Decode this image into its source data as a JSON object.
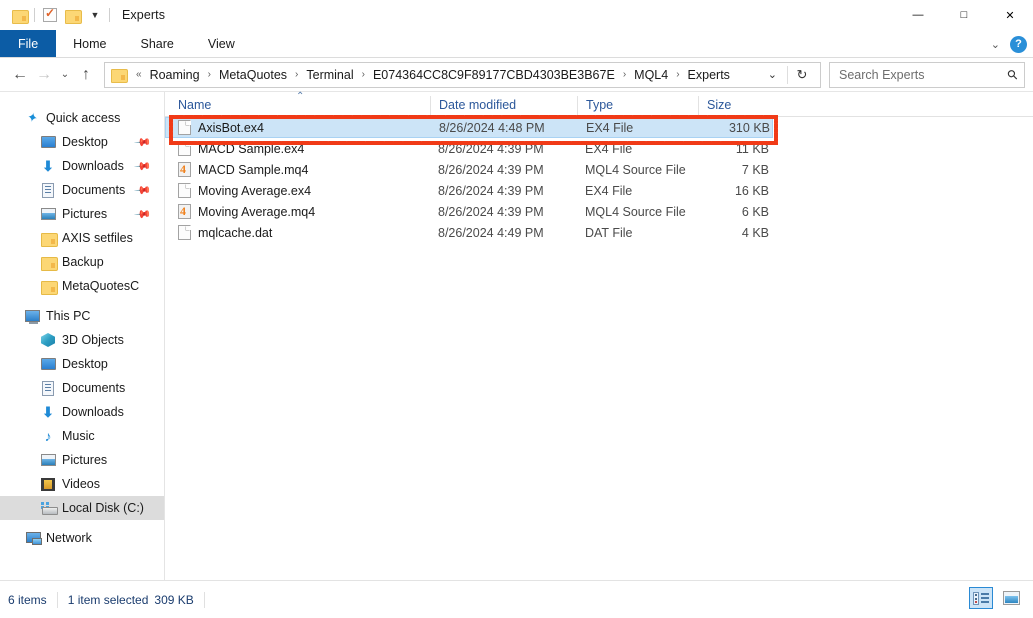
{
  "window": {
    "title": "Experts",
    "quick_access": [
      {
        "name": "folder-icon",
        "label": "Folder"
      },
      {
        "name": "properties-icon",
        "label": "Properties"
      },
      {
        "name": "new-folder-icon",
        "label": "New folder"
      },
      {
        "name": "customize-qat-caret",
        "label": "Customize Quick Access Toolbar"
      }
    ],
    "controls": {
      "minimize": "—",
      "maximize": "□",
      "close": "✕"
    }
  },
  "ribbon": {
    "tabs": [
      {
        "label": "File",
        "active": true
      },
      {
        "label": "Home",
        "active": false
      },
      {
        "label": "Share",
        "active": false
      },
      {
        "label": "View",
        "active": false
      }
    ],
    "collapse_caret": "⌄",
    "help_label": "?"
  },
  "address_bar": {
    "back": "←",
    "forward": "→",
    "recent": "⌄",
    "up": "↑",
    "overflow": "«",
    "crumbs": [
      "Roaming",
      "MetaQuotes",
      "Terminal",
      "E074364CC8C9F89177CBD4303BE3B67E",
      "MQL4",
      "Experts"
    ],
    "separator": "›",
    "dropdown_caret": "⌄",
    "refresh": "↻"
  },
  "search": {
    "placeholder": "Search Experts",
    "value": "",
    "icon": "search-icon"
  },
  "nav_pane": {
    "items": [
      {
        "label": "Quick access",
        "icon": "star-pin-icon",
        "level": 0,
        "group": true,
        "pinned": false,
        "selected": false
      },
      {
        "label": "Desktop",
        "icon": "desktop-icon",
        "level": 1,
        "pinned": true,
        "selected": false
      },
      {
        "label": "Downloads",
        "icon": "downloads-icon",
        "level": 1,
        "pinned": true,
        "selected": false
      },
      {
        "label": "Documents",
        "icon": "documents-icon",
        "level": 1,
        "pinned": true,
        "selected": false
      },
      {
        "label": "Pictures",
        "icon": "pictures-icon",
        "level": 1,
        "pinned": true,
        "selected": false
      },
      {
        "label": "AXIS setfiles",
        "icon": "folder-icon",
        "level": 1,
        "pinned": false,
        "selected": false
      },
      {
        "label": "Backup",
        "icon": "folder-icon",
        "level": 1,
        "pinned": false,
        "selected": false
      },
      {
        "label": "MetaQuotesC",
        "icon": "folder-icon",
        "level": 1,
        "pinned": false,
        "selected": false
      },
      {
        "label": "This PC",
        "icon": "this-pc-icon",
        "level": 0,
        "group": true,
        "pinned": false,
        "selected": false
      },
      {
        "label": "3D Objects",
        "icon": "3d-objects-icon",
        "level": 1,
        "pinned": false,
        "selected": false
      },
      {
        "label": "Desktop",
        "icon": "desktop-icon",
        "level": 1,
        "pinned": false,
        "selected": false
      },
      {
        "label": "Documents",
        "icon": "documents-icon",
        "level": 1,
        "pinned": false,
        "selected": false
      },
      {
        "label": "Downloads",
        "icon": "downloads-icon",
        "level": 1,
        "pinned": false,
        "selected": false
      },
      {
        "label": "Music",
        "icon": "music-icon",
        "level": 1,
        "pinned": false,
        "selected": false
      },
      {
        "label": "Pictures",
        "icon": "pictures-icon",
        "level": 1,
        "pinned": false,
        "selected": false
      },
      {
        "label": "Videos",
        "icon": "videos-icon",
        "level": 1,
        "pinned": false,
        "selected": false
      },
      {
        "label": "Local Disk (C:)",
        "icon": "local-disk-icon",
        "level": 1,
        "pinned": false,
        "selected": true
      },
      {
        "label": "Network",
        "icon": "network-icon",
        "level": 0,
        "group": true,
        "pinned": false,
        "selected": false
      }
    ]
  },
  "file_list": {
    "columns": [
      {
        "label": "Name",
        "key": "name"
      },
      {
        "label": "Date modified",
        "key": "date"
      },
      {
        "label": "Type",
        "key": "type"
      },
      {
        "label": "Size",
        "key": "size"
      }
    ],
    "sort_column": "Name",
    "sort_direction": "ascending",
    "sort_glyph": "⌃",
    "rows": [
      {
        "name": "AxisBot.ex4",
        "date": "8/26/2024 4:48 PM",
        "type": "EX4 File",
        "size": "310 KB",
        "icon": "generic-file-icon",
        "selected": true,
        "annotated": true
      },
      {
        "name": "MACD Sample.ex4",
        "date": "8/26/2024 4:39 PM",
        "type": "EX4 File",
        "size": "11 KB",
        "icon": "generic-file-icon",
        "selected": false,
        "annotated": false
      },
      {
        "name": "MACD Sample.mq4",
        "date": "8/26/2024 4:39 PM",
        "type": "MQL4 Source File",
        "size": "7 KB",
        "icon": "mq4-file-icon",
        "selected": false,
        "annotated": false
      },
      {
        "name": "Moving Average.ex4",
        "date": "8/26/2024 4:39 PM",
        "type": "EX4 File",
        "size": "16 KB",
        "icon": "generic-file-icon",
        "selected": false,
        "annotated": false
      },
      {
        "name": "Moving Average.mq4",
        "date": "8/26/2024 4:39 PM",
        "type": "MQL4 Source File",
        "size": "6 KB",
        "icon": "mq4-file-icon",
        "selected": false,
        "annotated": false
      },
      {
        "name": "mqlcache.dat",
        "date": "8/26/2024 4:49 PM",
        "type": "DAT File",
        "size": "4 KB",
        "icon": "generic-file-icon",
        "selected": false,
        "annotated": false
      }
    ]
  },
  "annotation": {
    "color": "#f03a17",
    "target": "AxisBot.ex4"
  },
  "status_bar": {
    "item_count": "6 items",
    "selection": "1 item selected",
    "selection_size": "309 KB",
    "views": [
      {
        "name": "details-view-button",
        "label": "Details view",
        "active": true
      },
      {
        "name": "large-icons-view-button",
        "label": "Large icons view",
        "active": false
      }
    ]
  },
  "colors": {
    "file_tab": "#0c5ca5",
    "selection": "#cce4f7",
    "selection_border": "#a9d2f3",
    "column_header_text": "#2b579a",
    "nav_selected": "#dcdcdc",
    "annotation_red": "#f03a17",
    "help_blue": "#2a8fd8"
  }
}
